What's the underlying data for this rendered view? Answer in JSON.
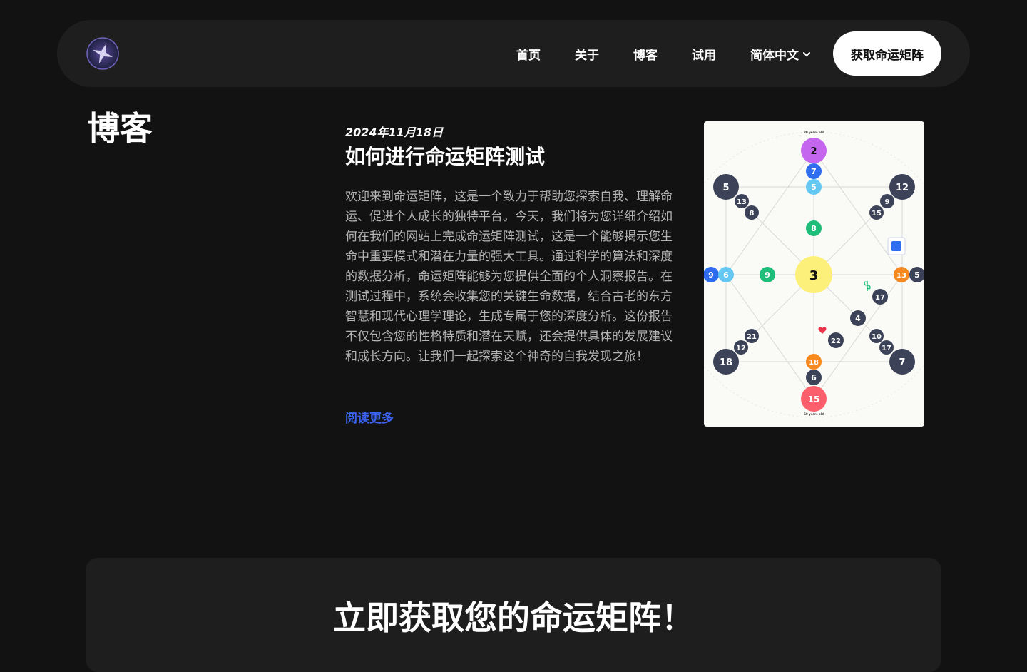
{
  "nav": {
    "links": [
      {
        "label": "首页"
      },
      {
        "label": "关于"
      },
      {
        "label": "博客"
      },
      {
        "label": "试用"
      }
    ],
    "language": "简体中文",
    "cta": "获取命运矩阵"
  },
  "page": {
    "title": "博客"
  },
  "post": {
    "date": "2024年11月18日",
    "title": "如何进行命运矩阵测试",
    "excerpt": "欢迎来到命运矩阵，这是一个致力于帮助您探索自我、理解命运、促进个人成长的独特平台。今天，我们将为您详细介绍如何在我们的网站上完成命运矩阵测试，这是一个能够揭示您生命中重要模式和潜在力量的强大工具。通过科学的算法和深度的数据分析，命运矩阵能够为您提供全面的个人洞察报告。在测试过程中，系统会收集您的关键生命数据，结合古老的东方智慧和现代心理学理论，生成专属于您的深度分析。这份报告不仅包含您的性格特质和潜在天赋，还会提供具体的发展建议和成长方向。让我们一起探索这个神奇的自我发现之旅！",
    "read_more": "阅读更多",
    "matrix": {
      "center": "3",
      "top": "2",
      "bottom": "15",
      "left": "9",
      "right": "5",
      "top_left": "5",
      "top_right": "12",
      "bottom_left": "18",
      "bottom_right": "7",
      "inner": [
        "7",
        "5",
        "8",
        "6",
        "9",
        "13",
        "13",
        "8",
        "9",
        "15",
        "17",
        "4",
        "22",
        "21",
        "12",
        "10",
        "17",
        "18",
        "6"
      ],
      "age_labels": {
        "top": "20 years old",
        "bottom": "60 years old"
      }
    }
  },
  "cta_section": {
    "heading": "立即获取您的命运矩阵！"
  },
  "colors": {
    "background": "#121212",
    "surface": "#1e1e1e",
    "link_blue": "#3b63f0",
    "matrix_purple": "#c467ee",
    "matrix_yellow": "#fdf07a",
    "matrix_red": "#fb5f6b",
    "matrix_navy": "#3c4258"
  }
}
